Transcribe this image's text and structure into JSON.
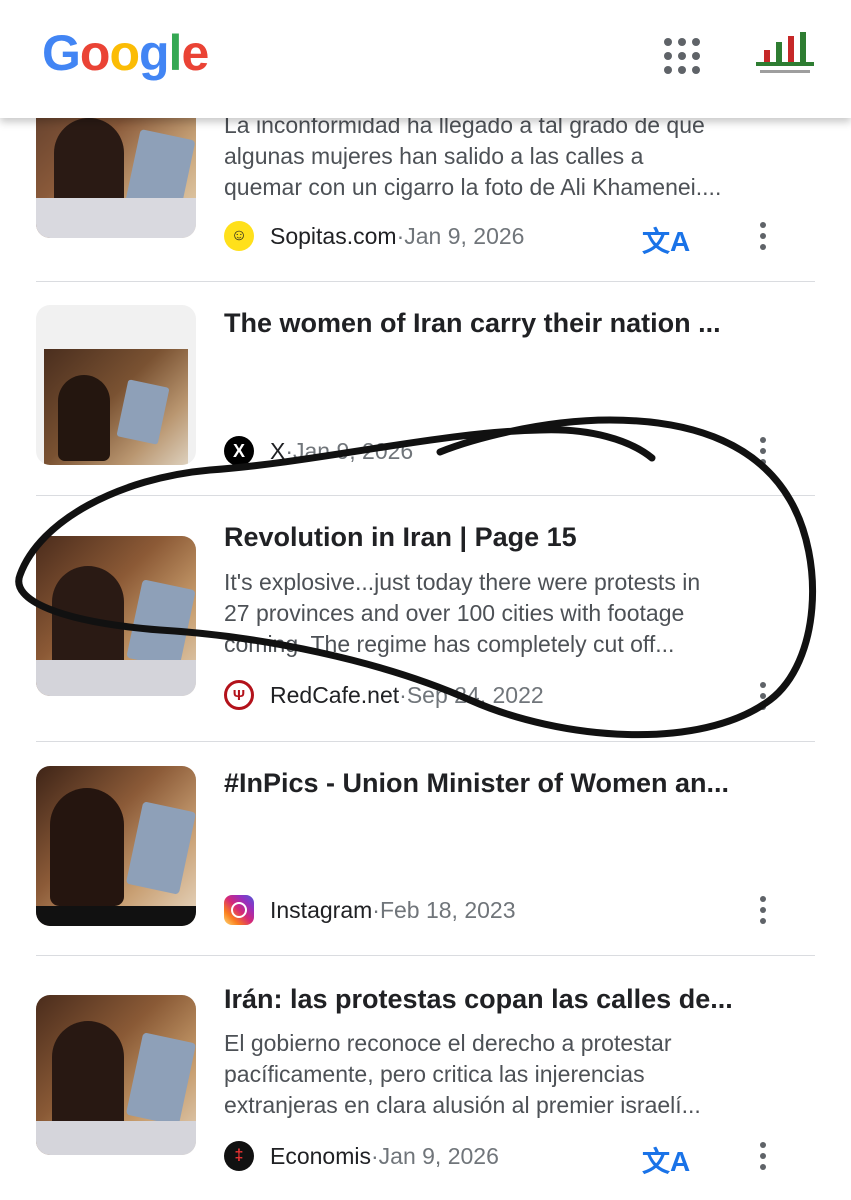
{
  "header": {
    "logo": [
      "G",
      "o",
      "o",
      "g",
      "l",
      "e"
    ],
    "logo_colors": [
      "#4285F4",
      "#EA4335",
      "#FBBC05",
      "#4285F4",
      "#34A853",
      "#EA4335"
    ],
    "apps_icon": "apps-grid-icon",
    "avatar_icon": "account-avatar-icon"
  },
  "results": [
    {
      "title": "",
      "snippet": [
        "La inconformidad ha llegado a tal grado de que",
        "algunas mujeres han salido a las calles a",
        "quemar con un cigarro la foto de Ali Khamenei...."
      ],
      "source": "Sopitas.com",
      "date": "Jan 9, 2026",
      "source_icon": "smiley-icon",
      "source_color": "#FFE01B",
      "translate": true
    },
    {
      "title": "The women of Iran carry their nation ...",
      "snippet": [],
      "source": "X",
      "date": "Jan 9, 2026",
      "source_icon": "x-logo-icon",
      "source_color": "#000000",
      "translate": false
    },
    {
      "title": "Revolution in Iran | Page 15",
      "snippet": [
        "It's explosive...just today there were protests in",
        "27 provinces and over 100 cities with footage",
        "coming. The regime has completely cut off..."
      ],
      "source": "RedCafe.net",
      "date": "Sep 24, 2022",
      "source_icon": "redcafe-devil-icon",
      "source_color": "#B3121B",
      "translate": false
    },
    {
      "title": "#InPics - Union Minister of Women an...",
      "snippet": [],
      "source": "Instagram",
      "date": "Feb 18, 2023",
      "source_icon": "instagram-icon",
      "source_color": "#DD2A7B",
      "translate": false
    },
    {
      "title": "Irán: las protestas copan las calles de...",
      "snippet": [
        "El gobierno reconoce el derecho a protestar",
        "pacíficamente, pero critica las injerencias",
        "extranjeras en clara alusión al premier israelí..."
      ],
      "source": "Economis",
      "date": "Jan 9, 2026",
      "source_icon": "economis-icon",
      "source_color": "#8B0000",
      "translate": true
    }
  ],
  "date_separator": " · ",
  "translate_glyph": "文A",
  "annotation": "hand-drawn-circle-around-result-3"
}
